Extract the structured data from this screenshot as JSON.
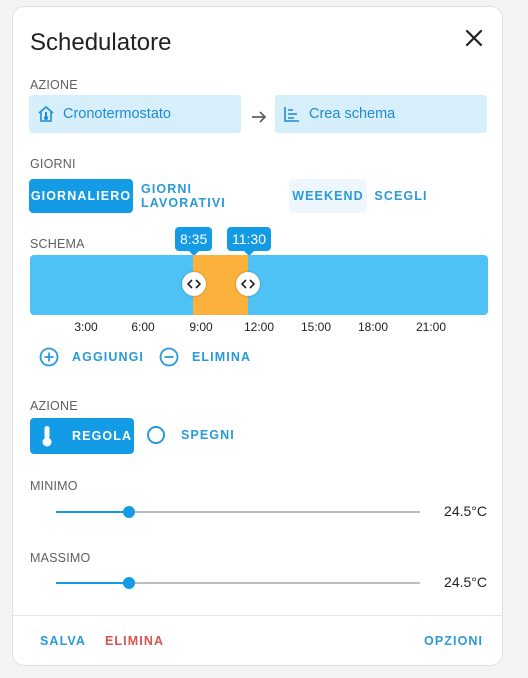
{
  "dialog": {
    "title": "Schedulatore"
  },
  "action_section": {
    "label": "AZIONE",
    "entity": "Cronotermostato",
    "target": "Crea schema"
  },
  "days_section": {
    "label": "GIORNI",
    "tabs": [
      "GIORNALIERO",
      "GIORNI LAVORATIVI",
      "WEEKEND",
      "SCEGLI"
    ],
    "selected": "GIORNALIERO"
  },
  "schema_section": {
    "label": "SCHEMA",
    "slot_start": "8:35",
    "slot_end": "11:30",
    "ticks": [
      "3:00",
      "6:00",
      "9:00",
      "12:00",
      "15:00",
      "18:00",
      "21:00"
    ],
    "add_label": "AGGIUNGI",
    "delete_label": "ELIMINA"
  },
  "action2_section": {
    "label": "AZIONE",
    "set_label": "REGOLA",
    "off_label": "SPEGNI"
  },
  "min_section": {
    "label": "MINIMO",
    "value": "24.5°C",
    "fraction": 0.2
  },
  "max_section": {
    "label": "MASSIMO",
    "value": "24.5°C",
    "fraction": 0.2
  },
  "footer": {
    "save": "SALVA",
    "delete": "ELIMINA",
    "options": "OPZIONI"
  },
  "colors": {
    "accent": "#149be6",
    "timeline": "#4fc2f5",
    "slot": "#fbb13c",
    "danger": "#d9534f"
  },
  "icons": {
    "close": "close-icon",
    "entity": "home-thermometer-icon",
    "target": "schema-icon",
    "arrow": "arrow-right-icon",
    "add": "plus-circle-icon",
    "delete": "minus-circle-icon",
    "set": "thermometer-icon"
  }
}
